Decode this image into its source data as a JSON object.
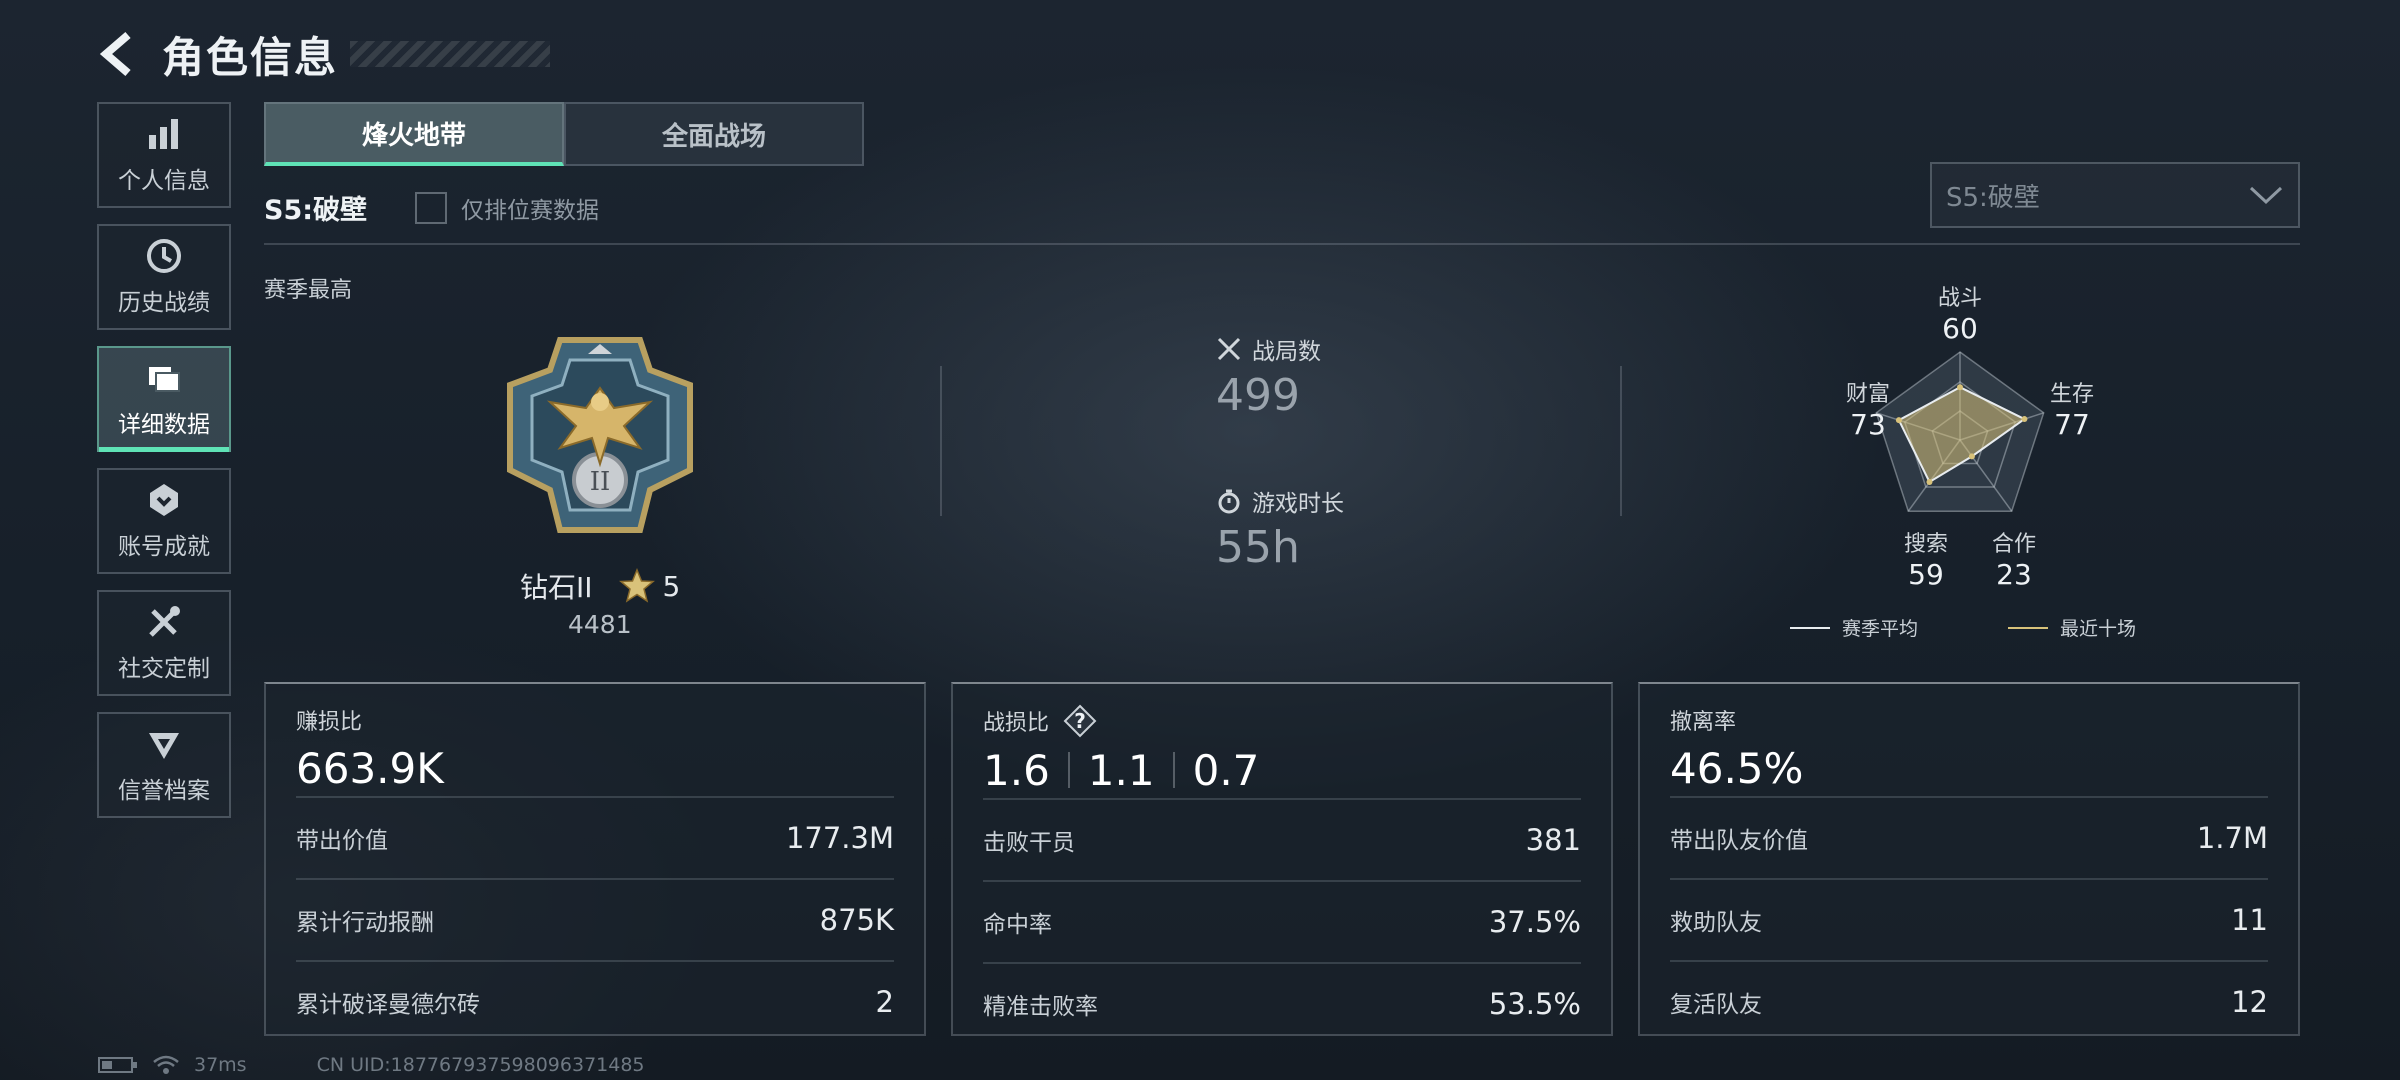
{
  "header": {
    "title": "角色信息"
  },
  "sidebar": {
    "items": [
      {
        "label": "个人信息",
        "icon": "bar-chart-icon"
      },
      {
        "label": "历史战绩",
        "icon": "clock-icon"
      },
      {
        "label": "详细数据",
        "icon": "folder-icon",
        "active": true
      },
      {
        "label": "账号成就",
        "icon": "badge-icon"
      },
      {
        "label": "社交定制",
        "icon": "tools-icon"
      },
      {
        "label": "信誉档案",
        "icon": "credit-icon"
      }
    ]
  },
  "tabs": [
    {
      "label": "烽火地带",
      "active": true
    },
    {
      "label": "全面战场",
      "active": false
    }
  ],
  "season": {
    "label": "S5:破壁",
    "ranked_only_label": "仅排位赛数据",
    "select_value": "S5:破壁"
  },
  "best": {
    "title": "赛季最高",
    "rank_name": "钻石II",
    "stars": "5",
    "score": "4481"
  },
  "stats": {
    "matches_label": "战局数",
    "matches_value": "499",
    "playtime_label": "游戏时长",
    "playtime_value": "55h"
  },
  "radar": {
    "axes": [
      {
        "name": "战斗",
        "value": "60"
      },
      {
        "name": "生存",
        "value": "77"
      },
      {
        "name": "合作",
        "value": "23"
      },
      {
        "name": "搜索",
        "value": "59"
      },
      {
        "name": "财富",
        "value": "73"
      }
    ],
    "legend_avg": "赛季平均",
    "legend_recent": "最近十场",
    "colors": {
      "avg": "#e8ecef",
      "recent": "#d8c27a"
    }
  },
  "panels": {
    "profit": {
      "title": "赚损比",
      "big": "663.9K",
      "rows": [
        {
          "label": "带出价值",
          "value": "177.3M"
        },
        {
          "label": "累计行动报酬",
          "value": "875K"
        },
        {
          "label": "累计破译曼德尔砖",
          "value": "2"
        }
      ]
    },
    "kd": {
      "title": "战损比",
      "ratios": [
        "1.6",
        "1.1",
        "0.7"
      ],
      "rows": [
        {
          "label": "击败干员",
          "value": "381"
        },
        {
          "label": "命中率",
          "value": "37.5%"
        },
        {
          "label": "精准击败率",
          "value": "53.5%"
        }
      ]
    },
    "extract": {
      "title": "撤离率",
      "big": "46.5%",
      "rows": [
        {
          "label": "带出队友价值",
          "value": "1.7M"
        },
        {
          "label": "救助队友",
          "value": "11"
        },
        {
          "label": "复活队友",
          "value": "12"
        }
      ]
    }
  },
  "footer": {
    "ping": "37ms",
    "uid": "CN UID:18776793759809637148​5"
  },
  "accent": "#5fe3b6"
}
